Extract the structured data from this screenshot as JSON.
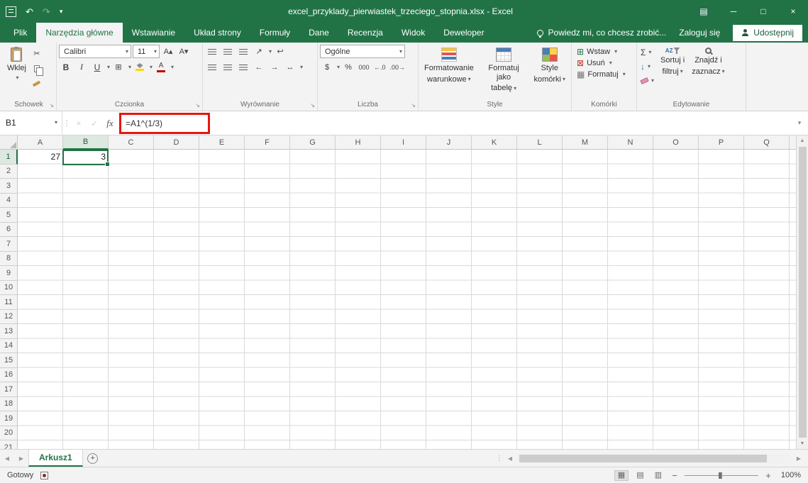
{
  "window": {
    "title": "excel_przyklady_pierwiastek_trzeciego_stopnia.xlsx - Excel"
  },
  "ribbon": {
    "tabs": [
      {
        "label": "Plik"
      },
      {
        "label": "Narzędzia główne"
      },
      {
        "label": "Wstawianie"
      },
      {
        "label": "Układ strony"
      },
      {
        "label": "Formuły"
      },
      {
        "label": "Dane"
      },
      {
        "label": "Recenzja"
      },
      {
        "label": "Widok"
      },
      {
        "label": "Deweloper"
      }
    ],
    "tell_me": "Powiedz mi, co chcesz zrobić...",
    "sign_in": "Zaloguj się",
    "share": "Udostępnij",
    "clipboard": {
      "label": "Schowek",
      "paste": "Wklej"
    },
    "font": {
      "label": "Czcionka",
      "family": "Calibri",
      "size": "11"
    },
    "alignment": {
      "label": "Wyrównanie"
    },
    "number": {
      "label": "Liczba",
      "format": "Ogólne"
    },
    "styles": {
      "label": "Style",
      "conditional_line1": "Formatowanie",
      "conditional_line2": "warunkowe",
      "table_line1": "Formatuj jako",
      "table_line2": "tabelę",
      "cellstyles_line1": "Style",
      "cellstyles_line2": "komórki"
    },
    "cells": {
      "label": "Komórki",
      "insert": "Wstaw",
      "delete": "Usuń",
      "format": "Formatuj"
    },
    "editing": {
      "label": "Edytowanie",
      "sort_line1": "Sortuj i",
      "sort_line2": "filtruj",
      "find_line1": "Znajdź i",
      "find_line2": "zaznacz"
    }
  },
  "formula_bar": {
    "name_box": "B1",
    "fx": "fx",
    "formula": "=A1^(1/3)"
  },
  "grid": {
    "columns": [
      "A",
      "B",
      "C",
      "D",
      "E",
      "F",
      "G",
      "H",
      "I",
      "J",
      "K",
      "L",
      "M",
      "N",
      "O",
      "P",
      "Q"
    ],
    "rows": 21,
    "selected_cell": "B1",
    "selected_column": "B",
    "selected_row": 1,
    "cells": [
      {
        "ref": "A1",
        "value": "27"
      },
      {
        "ref": "B1",
        "value": "3"
      }
    ]
  },
  "sheet_tabs": {
    "active": "Arkusz1"
  },
  "status_bar": {
    "status": "Gotowy",
    "zoom": "100%"
  },
  "colors": {
    "excel_green": "#217346",
    "formula_highlight": "#e8150f",
    "font_color_bar": "#c00000",
    "fill_color_bar": "#ffd400"
  },
  "icons": {
    "dropdown": "▾",
    "undo": "↶",
    "redo": "↷",
    "ribbon_options": "▤",
    "minimize": "─",
    "maximize": "□",
    "close": "×",
    "scissors": "✂",
    "launcher": "↘",
    "vdots": "⋮",
    "cancel": "×",
    "check": "✓",
    "font_grow": "A▴",
    "font_shrink": "A▾",
    "bold": "B",
    "italic": "I",
    "underline": "U",
    "borders": "⊞",
    "letterA": "A",
    "orientation": "↗",
    "wrap": "↩",
    "merge": "↔",
    "indent_dec": "←",
    "indent_inc": "→",
    "currency": "$",
    "percent": "%",
    "thousands": "000",
    "dec_inc": "←.0",
    "dec_dec": ".00→",
    "sum": "Σ",
    "fill_down": "↓",
    "insert": "⊞",
    "delete": "⊠",
    "format_cells": "▦",
    "up": "▲",
    "down": "▼",
    "left": "◀",
    "right": "▶",
    "plus": "+",
    "minus": "−",
    "view_normal": "▦",
    "view_layout": "▤",
    "view_break": "▥",
    "az": "AZ"
  }
}
